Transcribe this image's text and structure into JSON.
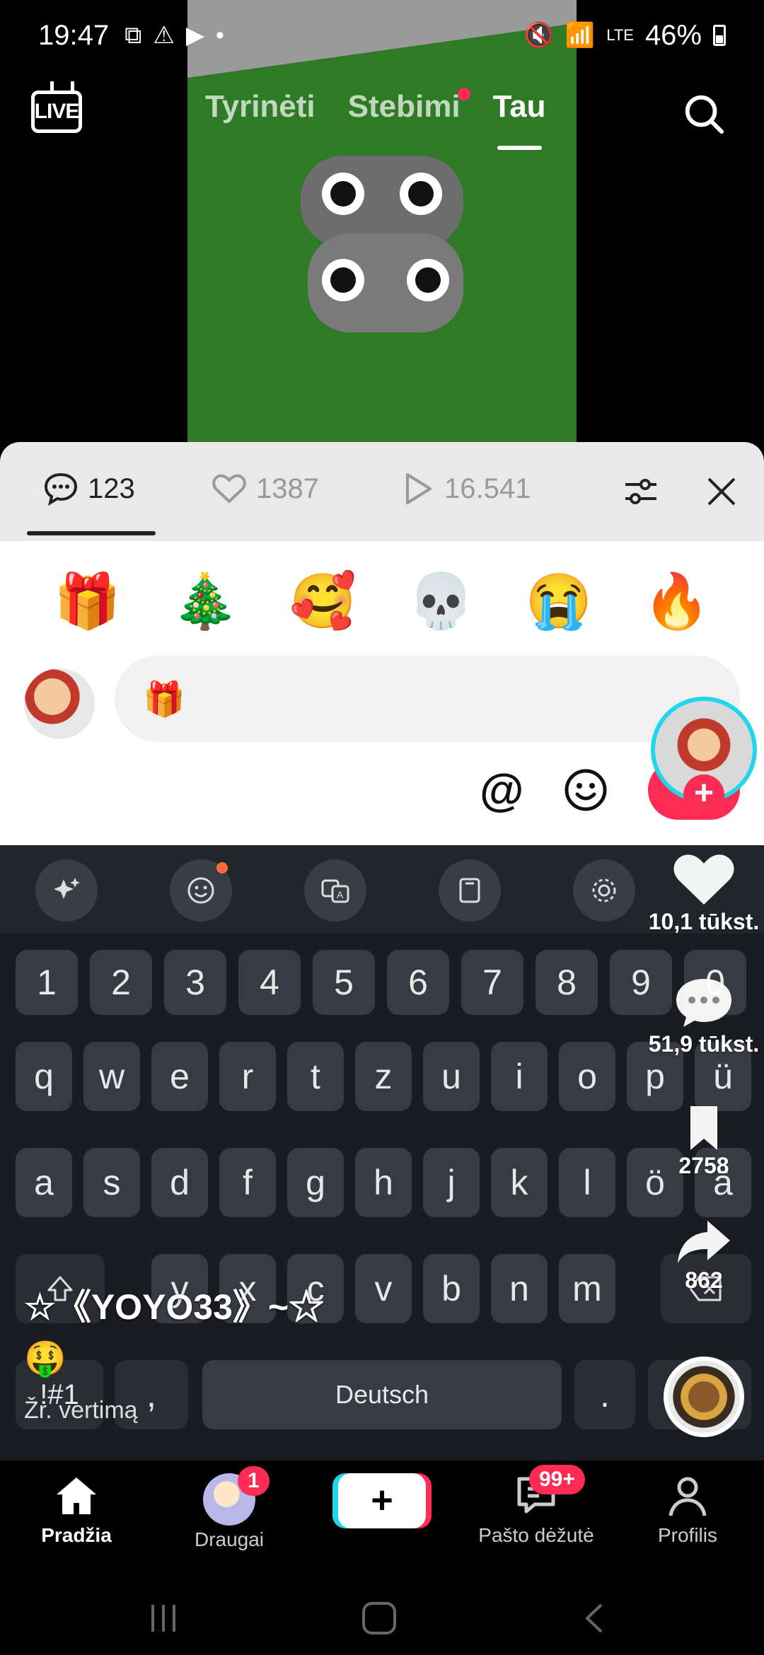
{
  "status_bar": {
    "time": "19:47",
    "battery": "46%",
    "network": "LTE"
  },
  "top_nav": {
    "live_label": "LIVE",
    "tabs": [
      {
        "label": "Tyrinėti"
      },
      {
        "label": "Stebimi"
      },
      {
        "label": "Tau"
      }
    ]
  },
  "comments_sheet": {
    "comments_count": "123",
    "likes_count": "1387",
    "views_count": "16.541"
  },
  "emoji_bar": [
    "🎁",
    "🎄",
    "🥰",
    "💀",
    "😭",
    "🔥"
  ],
  "comment_input": {
    "value": "🎁",
    "at_label": "@"
  },
  "keyboard": {
    "number_row": [
      "1",
      "2",
      "3",
      "4",
      "5",
      "6",
      "7",
      "8",
      "9",
      "0"
    ],
    "row1": [
      "q",
      "w",
      "e",
      "r",
      "t",
      "z",
      "u",
      "i",
      "o",
      "p",
      "ü"
    ],
    "row2": [
      "a",
      "s",
      "d",
      "f",
      "g",
      "h",
      "j",
      "k",
      "l",
      "ö",
      "ä"
    ],
    "row3": [
      "y",
      "x",
      "c",
      "v",
      "b",
      "n",
      "m"
    ],
    "symbols_label": "!#1",
    "comma_label": ",",
    "space_label": "Deutsch",
    "period_label": "."
  },
  "side_actions": {
    "likes": "10,1 tūkst.",
    "comments": "51,9 tūkst.",
    "saves": "2758",
    "shares": "862"
  },
  "video_caption": {
    "author": "☆《YOYO33》~☆",
    "emoji": "🤑",
    "translate_link": "Žr. vertimą"
  },
  "bottom_nav": {
    "home": "Pradžia",
    "friends": "Draugai",
    "friends_badge": "1",
    "inbox": "Pašto dėžutė",
    "inbox_badge": "99+",
    "profile": "Profilis",
    "create": "+"
  },
  "colors": {
    "accent": "#fe2c55",
    "cyan": "#20d5ec"
  }
}
